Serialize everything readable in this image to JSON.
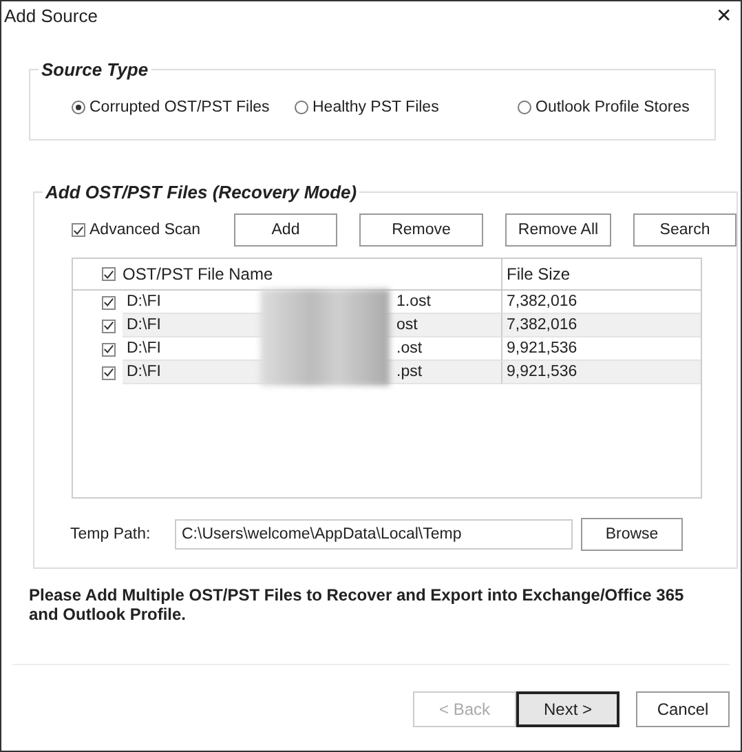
{
  "window": {
    "title": "Add Source",
    "close": "✕"
  },
  "source_type": {
    "title": "Source Type",
    "options": [
      {
        "label": "Corrupted OST/PST Files",
        "selected": true
      },
      {
        "label": "Healthy PST Files",
        "selected": false
      },
      {
        "label": "Outlook Profile Stores",
        "selected": false
      }
    ]
  },
  "files": {
    "title": "Add OST/PST Files (Recovery Mode)",
    "advanced_scan": {
      "label": "Advanced Scan",
      "checked": true
    },
    "buttons": [
      "Add",
      "Remove",
      "Remove All",
      "Search"
    ],
    "table": {
      "header_checked": true,
      "columns": [
        "OST/PST File Name",
        "File Size"
      ],
      "rows": [
        {
          "checked": true,
          "name_start": "D:\\FI",
          "name_end": "1.ost",
          "size": "7,382,016"
        },
        {
          "checked": true,
          "name_start": "D:\\FI",
          "name_end": "ost",
          "size": "7,382,016"
        },
        {
          "checked": true,
          "name_start": "D:\\FI",
          "name_end": ".ost",
          "size": "9,921,536"
        },
        {
          "checked": true,
          "name_start": "D:\\FI",
          "name_end": ".pst",
          "size": "9,921,536"
        }
      ]
    },
    "temp_path": {
      "label": "Temp Path:",
      "value": "C:\\Users\\welcome\\AppData\\Local\\Temp",
      "button": "Browse"
    }
  },
  "message": "Please Add Multiple OST/PST Files to Recover and Export into Exchange/Office 365 and Outlook Profile.",
  "footer": [
    {
      "label": "< Back",
      "disabled": true,
      "default": false
    },
    {
      "label": "Next >",
      "disabled": false,
      "default": true
    },
    {
      "label": "Cancel",
      "disabled": false,
      "default": false
    }
  ]
}
